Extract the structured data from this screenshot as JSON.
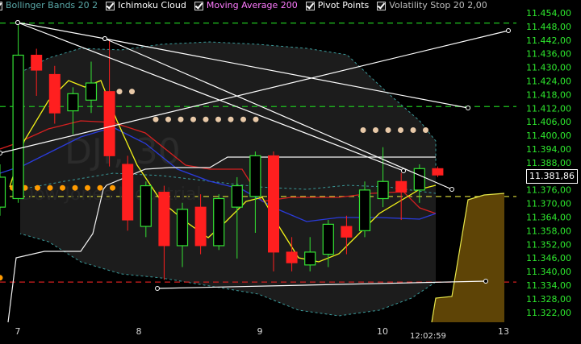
{
  "indicators": [
    {
      "label": "Bollinger Bands 20 2",
      "color": "#5aa9a9"
    },
    {
      "label": "Ichimoku Cloud",
      "color": "#ffffff"
    },
    {
      "label": "Moving Average 200",
      "color": "#ff7bff"
    },
    {
      "label": "Pivot Points",
      "color": "#ffffff"
    },
    {
      "label": "Volatility Stop 20 2,00",
      "color": "#bdbdbd"
    }
  ],
  "watermark": {
    "symbol": "DJI, 30",
    "name": "Dow Jones Industrial"
  },
  "current_price": "11.381,86",
  "crosshair_time": "12:02:59",
  "chart_data": {
    "type": "candlestick",
    "y_ticks": [
      "11.454,00",
      "11.448,00",
      "11.442,00",
      "11.436,00",
      "11.430,00",
      "11.424,00",
      "11.418,00",
      "11.412,00",
      "11.406,00",
      "11.400,00",
      "11.394,00",
      "11.388,00",
      "11.382,00",
      "11.376,00",
      "11.370,00",
      "11.364,00",
      "11.358,00",
      "11.352,00",
      "11.346,00",
      "11.340,00",
      "11.334,00",
      "11.328,00",
      "11.322,00"
    ],
    "x_ticks": [
      "7",
      "8",
      "9",
      "10",
      "13"
    ],
    "ylim": [
      11319,
      11456
    ],
    "candles": [
      {
        "o": 11366,
        "h": 11386,
        "l": 11362,
        "c": 11380
      },
      {
        "o": 11370,
        "h": 11453,
        "l": 11368,
        "c": 11437
      },
      {
        "o": 11437,
        "h": 11440,
        "l": 11418,
        "c": 11430
      },
      {
        "o": 11428,
        "h": 11432,
        "l": 11405,
        "c": 11410
      },
      {
        "o": 11411,
        "h": 11422,
        "l": 11400,
        "c": 11419
      },
      {
        "o": 11416,
        "h": 11434,
        "l": 11410,
        "c": 11424
      },
      {
        "o": 11420,
        "h": 11444,
        "l": 11385,
        "c": 11390
      },
      {
        "o": 11386,
        "h": 11390,
        "l": 11355,
        "c": 11360
      },
      {
        "o": 11357,
        "h": 11378,
        "l": 11352,
        "c": 11376
      },
      {
        "o": 11373,
        "h": 11376,
        "l": 11332,
        "c": 11348
      },
      {
        "o": 11348,
        "h": 11368,
        "l": 11338,
        "c": 11365
      },
      {
        "o": 11366,
        "h": 11372,
        "l": 11344,
        "c": 11348
      },
      {
        "o": 11348,
        "h": 11372,
        "l": 11346,
        "c": 11370
      },
      {
        "o": 11366,
        "h": 11380,
        "l": 11342,
        "c": 11376
      },
      {
        "o": 11371,
        "h": 11392,
        "l": 11354,
        "c": 11390
      },
      {
        "o": 11390,
        "h": 11392,
        "l": 11336,
        "c": 11345
      },
      {
        "o": 11345,
        "h": 11352,
        "l": 11336,
        "c": 11340
      },
      {
        "o": 11339,
        "h": 11352,
        "l": 11336,
        "c": 11345
      },
      {
        "o": 11344,
        "h": 11360,
        "l": 11338,
        "c": 11358
      },
      {
        "o": 11357,
        "h": 11362,
        "l": 11344,
        "c": 11352
      },
      {
        "o": 11355,
        "h": 11378,
        "l": 11352,
        "c": 11374
      },
      {
        "o": 11370,
        "h": 11394,
        "l": 11366,
        "c": 11378
      },
      {
        "o": 11378,
        "h": 11382,
        "l": 11360,
        "c": 11373
      },
      {
        "o": 11374,
        "h": 11386,
        "l": 11368,
        "c": 11384
      },
      {
        "o": 11384,
        "h": 11385,
        "l": 11380,
        "c": 11381
      }
    ],
    "h_lines": [
      {
        "price": 11452,
        "color": "#1fc41f"
      },
      {
        "price": 11413,
        "color": "#1fc41f"
      },
      {
        "price": 11371,
        "color": "#c9c934"
      },
      {
        "price": 11331,
        "color": "#d21f1f"
      }
    ],
    "pivot_dots": [
      {
        "price": 11420,
        "x1": 148,
        "x2": 175,
        "color": "#e8c9a8"
      },
      {
        "price": 11407,
        "x1": 193,
        "x2": 325,
        "color": "#e8c9a8"
      },
      {
        "price": 11402,
        "x1": 450,
        "x2": 540,
        "color": "#e8c9a8"
      },
      {
        "price": 11375,
        "x1": 0,
        "x2": 140,
        "color": "#ff9a00"
      },
      {
        "price": 11333,
        "x1": 0,
        "x2": 5,
        "color": "#ff9a00"
      }
    ]
  }
}
